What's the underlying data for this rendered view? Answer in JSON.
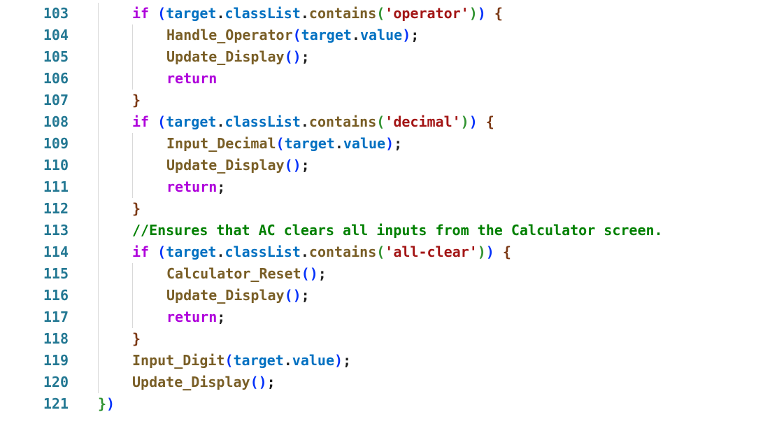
{
  "editor": {
    "lines": [
      {
        "num": "103",
        "indent": 1,
        "tokens": [
          {
            "t": "if",
            "c": "k"
          },
          {
            "t": " ",
            "c": "pl"
          },
          {
            "t": "(",
            "c": "p1"
          },
          {
            "t": "target",
            "c": "v"
          },
          {
            "t": ".",
            "c": "pl"
          },
          {
            "t": "classList",
            "c": "v"
          },
          {
            "t": ".",
            "c": "pl"
          },
          {
            "t": "contains",
            "c": "f"
          },
          {
            "t": "(",
            "c": "p2"
          },
          {
            "t": "'operator'",
            "c": "s"
          },
          {
            "t": ")",
            "c": "p2"
          },
          {
            "t": ")",
            "c": "p1"
          },
          {
            "t": " ",
            "c": "pl"
          },
          {
            "t": "{",
            "c": "p3"
          }
        ]
      },
      {
        "num": "104",
        "indent": 2,
        "tokens": [
          {
            "t": "Handle_Operator",
            "c": "f"
          },
          {
            "t": "(",
            "c": "p1"
          },
          {
            "t": "target",
            "c": "v"
          },
          {
            "t": ".",
            "c": "pl"
          },
          {
            "t": "value",
            "c": "v"
          },
          {
            "t": ")",
            "c": "p1"
          },
          {
            "t": ";",
            "c": "pl"
          }
        ]
      },
      {
        "num": "105",
        "indent": 2,
        "tokens": [
          {
            "t": "Update_Display",
            "c": "f"
          },
          {
            "t": "()",
            "c": "p1"
          },
          {
            "t": ";",
            "c": "pl"
          }
        ]
      },
      {
        "num": "106",
        "indent": 2,
        "tokens": [
          {
            "t": "return",
            "c": "k"
          }
        ]
      },
      {
        "num": "107",
        "indent": 1,
        "tokens": [
          {
            "t": "}",
            "c": "p3"
          }
        ]
      },
      {
        "num": "108",
        "indent": 1,
        "tokens": [
          {
            "t": "if",
            "c": "k"
          },
          {
            "t": " ",
            "c": "pl"
          },
          {
            "t": "(",
            "c": "p1"
          },
          {
            "t": "target",
            "c": "v"
          },
          {
            "t": ".",
            "c": "pl"
          },
          {
            "t": "classList",
            "c": "v"
          },
          {
            "t": ".",
            "c": "pl"
          },
          {
            "t": "contains",
            "c": "f"
          },
          {
            "t": "(",
            "c": "p2"
          },
          {
            "t": "'decimal'",
            "c": "s"
          },
          {
            "t": ")",
            "c": "p2"
          },
          {
            "t": ")",
            "c": "p1"
          },
          {
            "t": " ",
            "c": "pl"
          },
          {
            "t": "{",
            "c": "p3"
          }
        ]
      },
      {
        "num": "109",
        "indent": 2,
        "tokens": [
          {
            "t": "Input_Decimal",
            "c": "f"
          },
          {
            "t": "(",
            "c": "p1"
          },
          {
            "t": "target",
            "c": "v"
          },
          {
            "t": ".",
            "c": "pl"
          },
          {
            "t": "value",
            "c": "v"
          },
          {
            "t": ")",
            "c": "p1"
          },
          {
            "t": ";",
            "c": "pl"
          }
        ]
      },
      {
        "num": "110",
        "indent": 2,
        "tokens": [
          {
            "t": "Update_Display",
            "c": "f"
          },
          {
            "t": "()",
            "c": "p1"
          },
          {
            "t": ";",
            "c": "pl"
          }
        ]
      },
      {
        "num": "111",
        "indent": 2,
        "tokens": [
          {
            "t": "return",
            "c": "k"
          },
          {
            "t": ";",
            "c": "pl"
          }
        ]
      },
      {
        "num": "112",
        "indent": 1,
        "tokens": [
          {
            "t": "}",
            "c": "p3"
          }
        ]
      },
      {
        "num": "113",
        "indent": 1,
        "tokens": [
          {
            "t": "//Ensures that AC clears all inputs from the Calculator screen.",
            "c": "c"
          }
        ]
      },
      {
        "num": "114",
        "indent": 1,
        "tokens": [
          {
            "t": "if",
            "c": "k"
          },
          {
            "t": " ",
            "c": "pl"
          },
          {
            "t": "(",
            "c": "p1"
          },
          {
            "t": "target",
            "c": "v"
          },
          {
            "t": ".",
            "c": "pl"
          },
          {
            "t": "classList",
            "c": "v"
          },
          {
            "t": ".",
            "c": "pl"
          },
          {
            "t": "contains",
            "c": "f"
          },
          {
            "t": "(",
            "c": "p2"
          },
          {
            "t": "'all-clear'",
            "c": "s"
          },
          {
            "t": ")",
            "c": "p2"
          },
          {
            "t": ")",
            "c": "p1"
          },
          {
            "t": " ",
            "c": "pl"
          },
          {
            "t": "{",
            "c": "p3"
          }
        ]
      },
      {
        "num": "115",
        "indent": 2,
        "tokens": [
          {
            "t": "Calculator_Reset",
            "c": "f"
          },
          {
            "t": "()",
            "c": "p1"
          },
          {
            "t": ";",
            "c": "pl"
          }
        ]
      },
      {
        "num": "116",
        "indent": 2,
        "tokens": [
          {
            "t": "Update_Display",
            "c": "f"
          },
          {
            "t": "()",
            "c": "p1"
          },
          {
            "t": ";",
            "c": "pl"
          }
        ]
      },
      {
        "num": "117",
        "indent": 2,
        "tokens": [
          {
            "t": "return",
            "c": "k"
          },
          {
            "t": ";",
            "c": "pl"
          }
        ]
      },
      {
        "num": "118",
        "indent": 1,
        "tokens": [
          {
            "t": "}",
            "c": "p3"
          }
        ]
      },
      {
        "num": "119",
        "indent": 1,
        "tokens": [
          {
            "t": "Input_Digit",
            "c": "f"
          },
          {
            "t": "(",
            "c": "p1"
          },
          {
            "t": "target",
            "c": "v"
          },
          {
            "t": ".",
            "c": "pl"
          },
          {
            "t": "value",
            "c": "v"
          },
          {
            "t": ")",
            "c": "p1"
          },
          {
            "t": ";",
            "c": "pl"
          }
        ]
      },
      {
        "num": "120",
        "indent": 1,
        "tokens": [
          {
            "t": "Update_Display",
            "c": "f"
          },
          {
            "t": "()",
            "c": "p1"
          },
          {
            "t": ";",
            "c": "pl"
          }
        ]
      },
      {
        "num": "121",
        "indent": 0,
        "tokens": [
          {
            "t": "}",
            "c": "p2"
          },
          {
            "t": ")",
            "c": "p1"
          }
        ]
      }
    ]
  }
}
